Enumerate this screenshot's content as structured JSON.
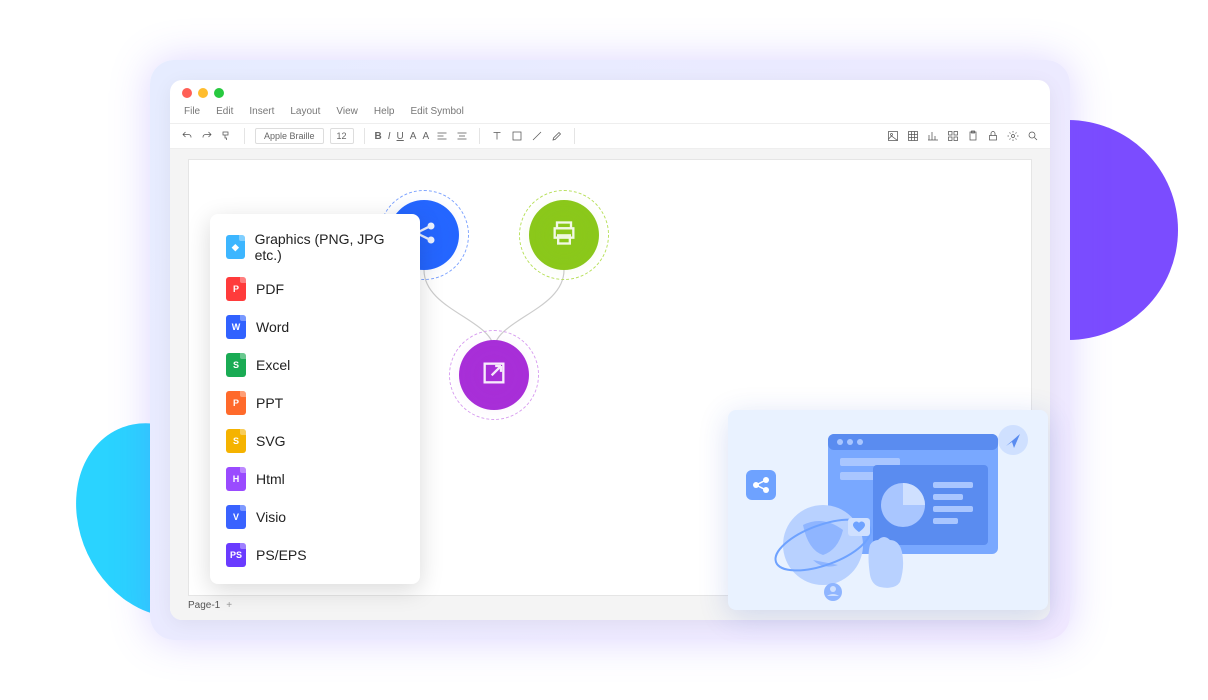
{
  "menubar": [
    "File",
    "Edit",
    "Insert",
    "Layout",
    "View",
    "Help",
    "Edit Symbol"
  ],
  "toolbar": {
    "font": "Apple Braille",
    "size": "12"
  },
  "format_icons": [
    "B",
    "I",
    "U",
    "A",
    "A"
  ],
  "page_tab": "Page-1",
  "export_menu": [
    {
      "label": "Graphics (PNG, JPG etc.)",
      "color": "#3db6ff",
      "tag": "◆"
    },
    {
      "label": "PDF",
      "color": "#ff3b3b",
      "tag": "P"
    },
    {
      "label": "Word",
      "color": "#3162ff",
      "tag": "W"
    },
    {
      "label": "Excel",
      "color": "#1aab54",
      "tag": "S"
    },
    {
      "label": "PPT",
      "color": "#ff6a2b",
      "tag": "P"
    },
    {
      "label": "SVG",
      "color": "#f5b300",
      "tag": "S"
    },
    {
      "label": "Html",
      "color": "#9a4bff",
      "tag": "H"
    },
    {
      "label": "Visio",
      "color": "#3a63ff",
      "tag": "V"
    },
    {
      "label": "PS/EPS",
      "color": "#6a3bff",
      "tag": "PS"
    }
  ]
}
